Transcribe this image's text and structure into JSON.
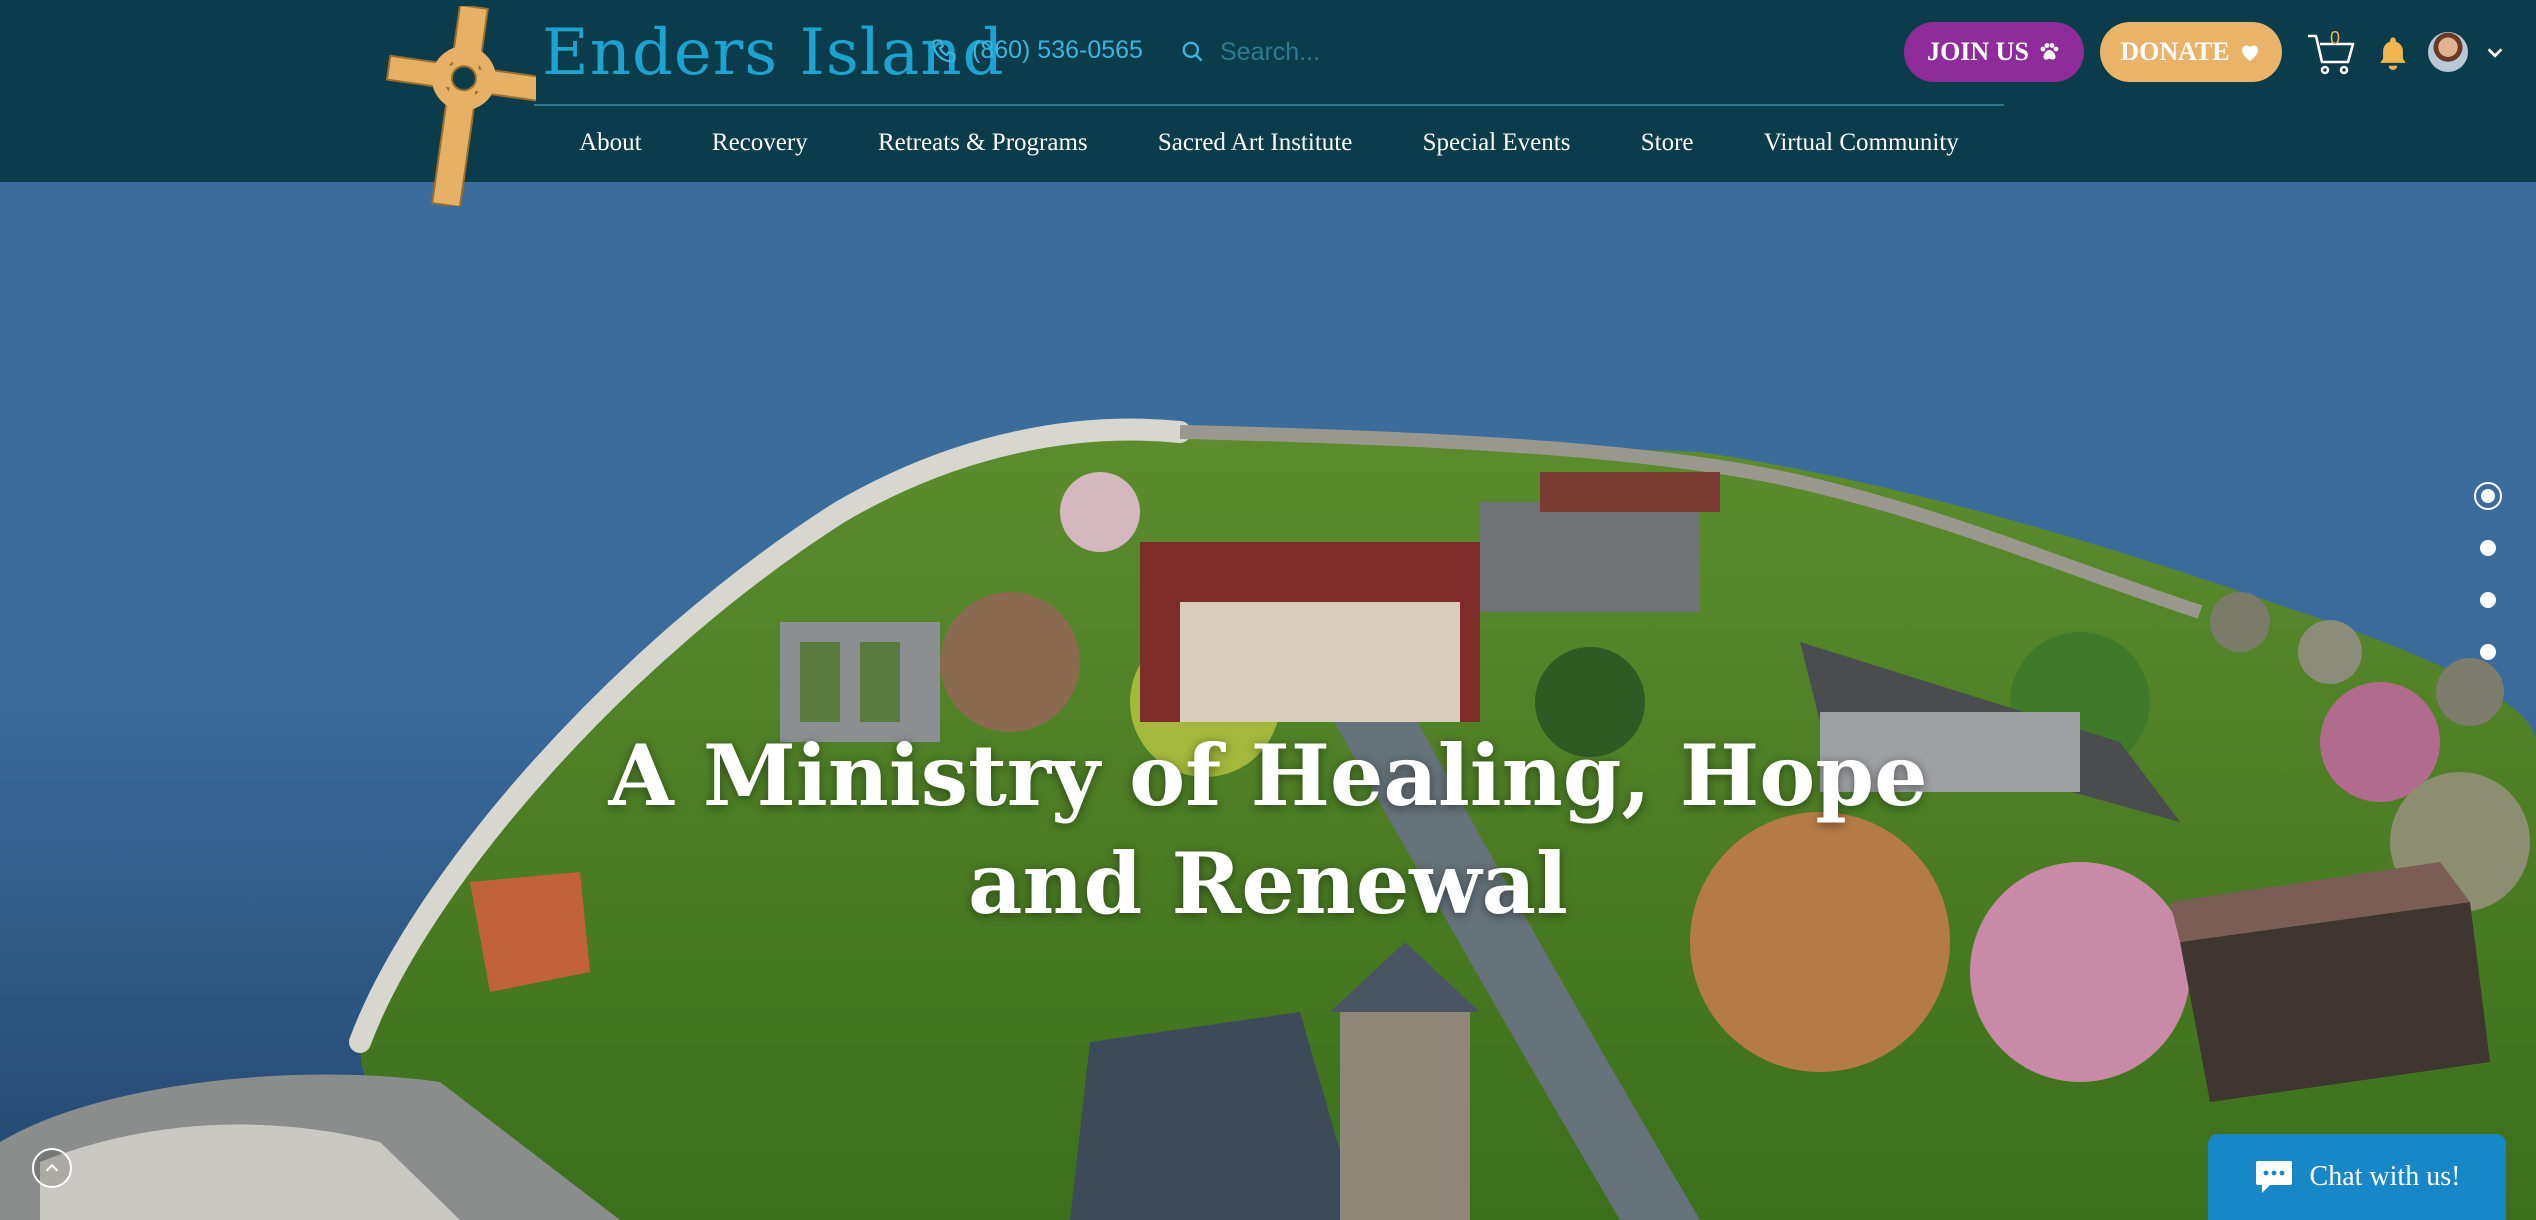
{
  "header": {
    "site_title": "Enders Island",
    "phone": "(860) 536-0565",
    "search_placeholder": "Search...",
    "join_label": "JOIN US",
    "donate_label": "DONATE",
    "cart_count": "0"
  },
  "nav": {
    "items": [
      {
        "label": "About"
      },
      {
        "label": "Recovery"
      },
      {
        "label": "Retreats & Programs"
      },
      {
        "label": "Sacred Art Institute"
      },
      {
        "label": "Special Events"
      },
      {
        "label": "Store"
      },
      {
        "label": "Virtual Community"
      }
    ]
  },
  "hero": {
    "title_line1": "A Ministry of Healing, Hope",
    "title_line2": "and Renewal",
    "slides_total": 4,
    "slide_active": 1
  },
  "chat": {
    "label": "Chat with us!"
  },
  "colors": {
    "header_bg": "#0b3c4c",
    "title_blue": "#1ca3cf",
    "join_purple": "#8e2c9a",
    "donate_gold": "#e9b46a",
    "cross_gold": "#e6b164",
    "chat_blue": "#1887c8"
  },
  "icons": {
    "phone": "phone-icon",
    "search": "search-icon",
    "join": "paw-icon",
    "donate": "heart-icon",
    "cart": "cart-icon",
    "bell": "bell-icon",
    "caret": "chevron-down-icon",
    "scroll_top": "chevron-up-icon",
    "chat": "chat-bubble-icon"
  }
}
